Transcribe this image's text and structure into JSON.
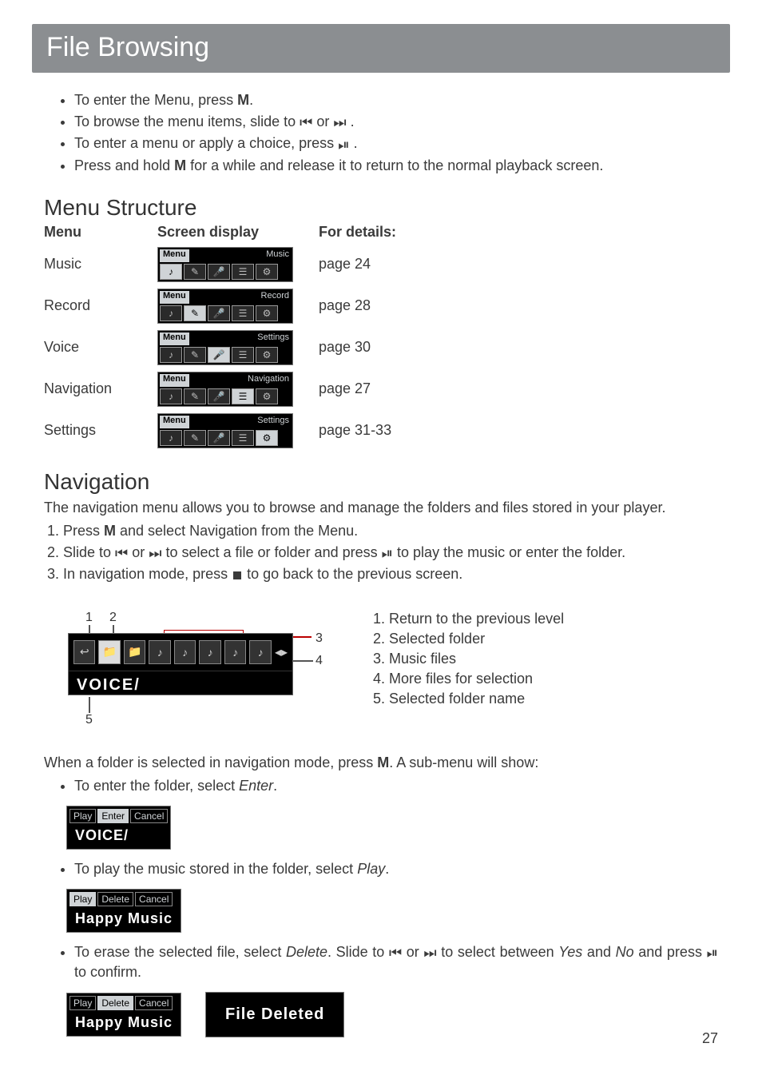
{
  "header": {
    "title": "File Browsing"
  },
  "intro_bullets": [
    {
      "pre": "To enter the Menu, press ",
      "bold": "M",
      "post": "."
    },
    {
      "pre": "To browse the menu items, slide to ",
      "glyph1": "⏮",
      "mid": " or ",
      "glyph2": "⏭",
      "post": " ."
    },
    {
      "pre": "To enter a menu or apply a choice, press ",
      "glyph1": "⏯",
      "post": " ."
    },
    {
      "pre": "Press and hold ",
      "bold": "M",
      "post": " for a while and release it to return to the normal playback screen."
    }
  ],
  "menu_structure": {
    "heading": "Menu Structure",
    "th1": "Menu",
    "th2": "Screen display",
    "th3": "For details:",
    "rows": [
      {
        "name": "Music",
        "lcd_label": "Music",
        "detail": "page 24"
      },
      {
        "name": "Record",
        "lcd_label": "Record",
        "detail": "page 28"
      },
      {
        "name": "Voice",
        "lcd_label": "Settings",
        "detail": "page 30"
      },
      {
        "name": "Navigation",
        "lcd_label": "Navigation",
        "detail": "page 27"
      },
      {
        "name": "Settings",
        "lcd_label": "Settings",
        "detail": "page 31-33"
      }
    ],
    "lcd_menu_tab": "Menu"
  },
  "navigation": {
    "heading": "Navigation",
    "intro": "The navigation menu allows you to browse and manage the folders and files stored in your player.",
    "steps": {
      "s1_pre": "Press ",
      "s1_bold": "M",
      "s1_post": " and select Navigation from the Menu.",
      "s2_pre": "Slide to ",
      "s2_g1": "⏮",
      "s2_mid1": " or ",
      "s2_g2": "⏭",
      "s2_mid2": " to select a file or folder and press ",
      "s2_g3": "⏯",
      "s2_post": " to play the music or enter the folder.",
      "s3_pre": "In navigation mode, press ",
      "s3_post": " to go back to the previous screen."
    },
    "callouts": {
      "c1": "1",
      "c2": "2",
      "c3": "3",
      "c4": "4",
      "c5": "5"
    },
    "folder_name": "VOICE/",
    "legend": [
      "Return to the previous level",
      "Selected folder",
      "Music files",
      "More files for selection",
      "Selected folder name"
    ]
  },
  "submenu": {
    "intro_pre": "When a folder is selected in navigation mode, press ",
    "intro_bold": "M",
    "intro_post": ". A sub-menu will show:",
    "b1_pre": "To enter the folder, select ",
    "b1_ital": "Enter",
    "b1_post": ".",
    "lcd1_opts": [
      "Play",
      "Enter",
      "Cancel"
    ],
    "lcd1_sel_index": 1,
    "lcd1_name": "VOICE/",
    "b2_pre": "To play the music stored in the folder, select ",
    "b2_ital": "Play",
    "b2_post": ".",
    "lcd2_opts": [
      "Play",
      "Delete",
      "Cancel"
    ],
    "lcd2_sel_index": 0,
    "lcd2_name": "Happy Music",
    "b3_pre": "To erase the selected file, select ",
    "b3_ital1": "Delete",
    "b3_mid1": ". Slide to ",
    "b3_g1": "⏮",
    "b3_mid2": " or ",
    "b3_g2": "⏭",
    "b3_mid3": " to select between ",
    "b3_ital2": "Yes",
    "b3_mid4": " and ",
    "b3_ital3": "No",
    "b3_mid5": " and press ",
    "b3_g3": "⏯",
    "b3_post": " to confirm.",
    "lcd3_opts": [
      "Play",
      "Delete",
      "Cancel"
    ],
    "lcd3_sel_index": 1,
    "lcd3_name": "Happy Music",
    "deleted_msg": "File Deleted"
  },
  "page_number": "27",
  "icons": {
    "note": "♪",
    "folder": "📁",
    "back": "↩"
  }
}
